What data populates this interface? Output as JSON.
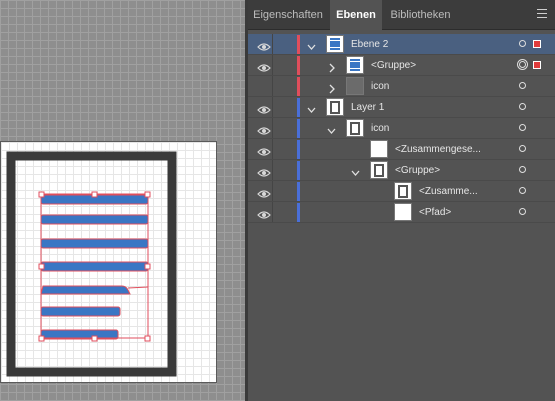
{
  "panel": {
    "tabs": [
      {
        "label": "Eigenschaften",
        "active": false
      },
      {
        "label": "Ebenen",
        "active": true
      },
      {
        "label": "Bibliotheken",
        "active": false
      }
    ],
    "menu_icon": "panel-menu-icon"
  },
  "layers": [
    {
      "name": "Ebene 2",
      "depth": 0,
      "expanded": true,
      "has_chevron": true,
      "visible": true,
      "color": "#e04e5c",
      "thumb": "lines",
      "selected": true,
      "target": "single",
      "selection_marker": true
    },
    {
      "name": "<Gruppe>",
      "depth": 1,
      "expanded": false,
      "has_chevron": true,
      "visible": true,
      "color": "#e04e5c",
      "thumb": "lines",
      "selected": false,
      "target": "double",
      "selection_marker": true
    },
    {
      "name": "icon",
      "depth": 1,
      "expanded": false,
      "has_chevron": true,
      "visible": false,
      "color": "#e04e5c",
      "thumb": "gray",
      "selected": false,
      "target": "single",
      "selection_marker": false
    },
    {
      "name": "Layer 1",
      "depth": 0,
      "expanded": true,
      "has_chevron": true,
      "visible": true,
      "color": "#4a6fd8",
      "thumb": "frame",
      "selected": false,
      "target": "single",
      "selection_marker": false
    },
    {
      "name": "icon",
      "depth": 1,
      "expanded": true,
      "has_chevron": true,
      "visible": true,
      "color": "#4a6fd8",
      "thumb": "frame",
      "selected": false,
      "target": "single",
      "selection_marker": false
    },
    {
      "name": "<Zusammengese...",
      "depth": 2,
      "expanded": false,
      "has_chevron": false,
      "visible": true,
      "color": "#4a6fd8",
      "thumb": "white",
      "selected": false,
      "target": "single",
      "selection_marker": false
    },
    {
      "name": "<Gruppe>",
      "depth": 2,
      "expanded": true,
      "has_chevron": true,
      "visible": true,
      "color": "#4a6fd8",
      "thumb": "frame",
      "selected": false,
      "target": "single",
      "selection_marker": false
    },
    {
      "name": "<Zusamme...",
      "depth": 3,
      "expanded": false,
      "has_chevron": false,
      "visible": true,
      "color": "#4a6fd8",
      "thumb": "frame",
      "selected": false,
      "target": "single",
      "selection_marker": false
    },
    {
      "name": "<Pfad>",
      "depth": 3,
      "expanded": false,
      "has_chevron": false,
      "visible": true,
      "color": "#4a6fd8",
      "thumb": "white",
      "selected": false,
      "target": "single",
      "selection_marker": false
    }
  ],
  "canvas": {
    "artwork": "document-icon-with-lines",
    "line_color": "#3a76c4",
    "selection_color": "#e04e5c",
    "frame_color": "#3a3a3a"
  }
}
